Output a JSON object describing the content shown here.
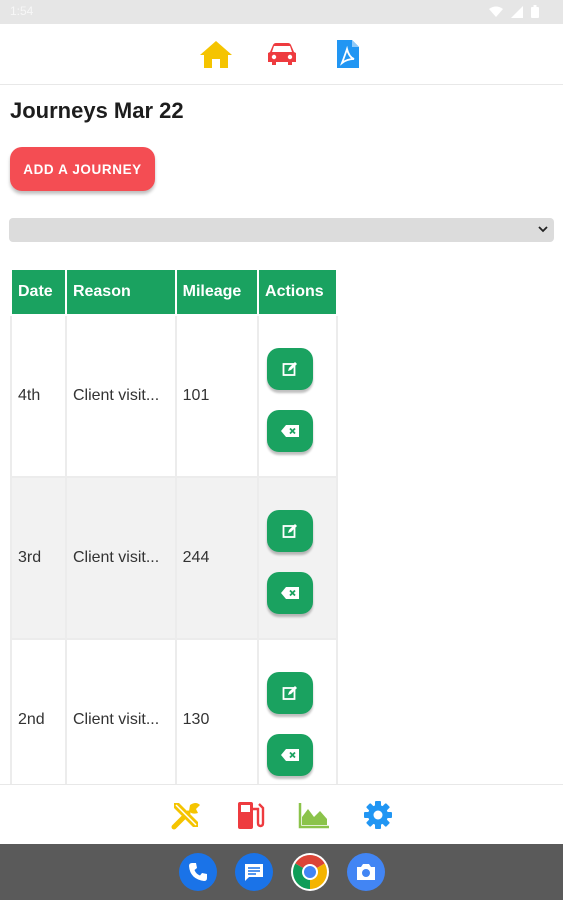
{
  "status_bar": {
    "time": "1:54"
  },
  "top_nav": {
    "items": [
      {
        "icon": "home-icon",
        "color": "#f5c400"
      },
      {
        "icon": "car-icon",
        "color": "#ee3b3f"
      },
      {
        "icon": "pdf-icon",
        "color": "#2196f3"
      }
    ]
  },
  "page": {
    "title": "Journeys Mar 22",
    "add_button_label": "ADD A JOURNEY",
    "select_value": ""
  },
  "table": {
    "headers": [
      "Date",
      "Reason",
      "Mileage",
      "Actions"
    ],
    "rows": [
      {
        "date": "4th",
        "reason": "Client visit...",
        "mileage": "101"
      },
      {
        "date": "3rd",
        "reason": "Client visit...",
        "mileage": "244"
      },
      {
        "date": "2nd",
        "reason": "Client visit...",
        "mileage": "130"
      }
    ],
    "row_actions": [
      {
        "icon": "edit-icon"
      },
      {
        "icon": "delete-icon"
      }
    ]
  },
  "bottom_nav": {
    "items": [
      {
        "icon": "tools-icon",
        "color": "#f5c400"
      },
      {
        "icon": "fuel-icon",
        "color": "#ee3b3f"
      },
      {
        "icon": "chart-icon",
        "color": "#8bc34a"
      },
      {
        "icon": "gear-icon",
        "color": "#2196f3"
      }
    ]
  },
  "dock": {
    "apps": [
      {
        "icon": "phone-icon"
      },
      {
        "icon": "messages-icon"
      },
      {
        "icon": "chrome-icon"
      },
      {
        "icon": "camera-icon"
      }
    ]
  },
  "colors": {
    "accent_green": "#1aa260",
    "accent_red": "#f44d53"
  }
}
